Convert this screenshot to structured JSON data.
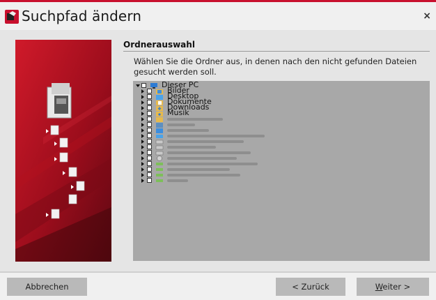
{
  "window": {
    "title": "Suchpfad ändern",
    "close_glyph": "×",
    "accent_color": "#c8102e"
  },
  "section": {
    "header": "Ordnerauswahl",
    "description": "Wählen Sie die Ordner aus, in denen nach den nicht gefunden Dateien gesucht werden soll."
  },
  "tree": {
    "root": {
      "label": "Dieser PC",
      "icon": "pc-icon",
      "expanded": true
    },
    "children": [
      {
        "label": "Bilder",
        "icon": "pictures-folder-icon"
      },
      {
        "label": "Desktop",
        "icon": "desktop-folder-icon"
      },
      {
        "label": "Dokumente",
        "icon": "documents-folder-icon"
      },
      {
        "label": "Downloads",
        "icon": "downloads-folder-icon"
      },
      {
        "label": "Musik",
        "icon": "music-folder-icon"
      }
    ],
    "redacted_rows": 11
  },
  "buttons": {
    "cancel": "Abbrechen",
    "back": "< Zurück",
    "next_mnemonic": "W",
    "next_rest": "eiter >"
  }
}
